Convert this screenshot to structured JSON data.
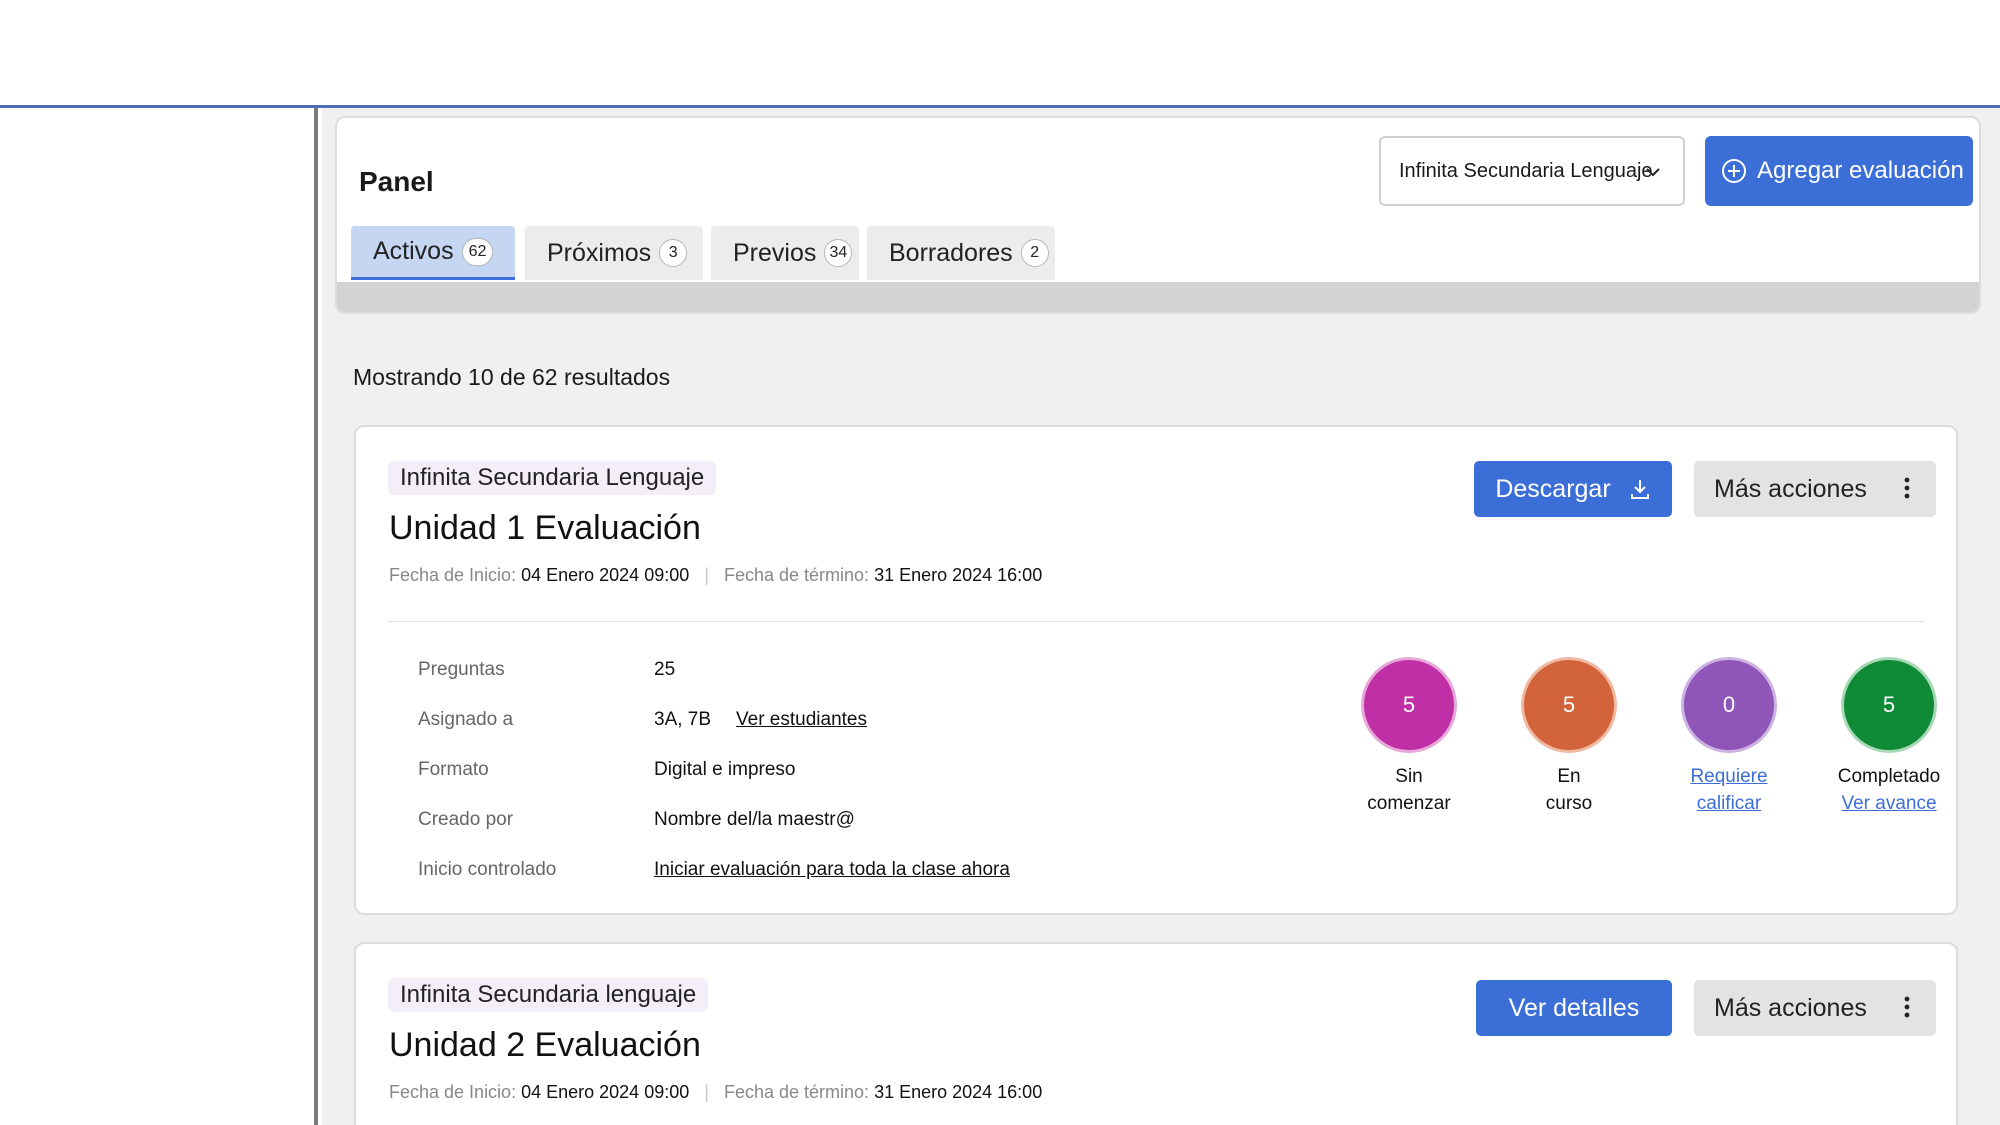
{
  "panel": {
    "title": "Panel",
    "school_select": "Infinita Secundaria Lenguaje",
    "add_label": "Agregar evaluación"
  },
  "tabs": [
    {
      "label": "Activos",
      "count": "62"
    },
    {
      "label": "Próximos",
      "count": "3"
    },
    {
      "label": "Previos",
      "count": "34"
    },
    {
      "label": "Borradores",
      "count": "2"
    }
  ],
  "results_text": "Mostrando 10 de 62 resultados",
  "cards": [
    {
      "school": "Infinita Secundaria Lenguaje",
      "title": "Unidad 1 Evaluación",
      "start_label": "Fecha de Inicio:",
      "start": "04 Enero 2024 09:00",
      "end_label": "Fecha de término:",
      "end": "31 Enero 2024 16:00",
      "primary_label": "Descargar",
      "more_label": "Más acciones",
      "details": {
        "questions_k": "Preguntas",
        "questions_v": "25",
        "assigned_k": "Asignado a",
        "assigned_v": "3A, 7B",
        "assigned_link": "Ver estudiantes",
        "format_k": "Formato",
        "format_v": "Digital e impreso",
        "creator_k": "Creado por",
        "creator_v": "Nombre del/la maestr@",
        "controlled_k": "Inicio controlado",
        "controlled_v": "Iniciar evaluación para toda la clase ahora"
      },
      "stats": [
        {
          "value": "5",
          "line1": "Sin",
          "line2": "comenzar",
          "color": "#c12fa6"
        },
        {
          "value": "5",
          "line1": "En",
          "line2": "curso",
          "color": "#d2633a"
        },
        {
          "value": "0",
          "line1": "Requiere",
          "line2": "calificar",
          "color": "#8f55b8"
        },
        {
          "value": "5",
          "line1": "Completado",
          "line2": "Ver avance",
          "color": "#0f8a36"
        }
      ]
    },
    {
      "school": "Infinita Secundaria lenguaje",
      "title": "Unidad 2 Evaluación",
      "start_label": "Fecha de Inicio:",
      "start": "04 Enero 2024 09:00",
      "end_label": "Fecha de término:",
      "end": "31 Enero 2024 16:00",
      "primary_label": "Ver detalles",
      "more_label": "Más acciones"
    }
  ],
  "colors": {
    "accent": "#3b6ed6",
    "frame_line": "#4a6fb0"
  }
}
